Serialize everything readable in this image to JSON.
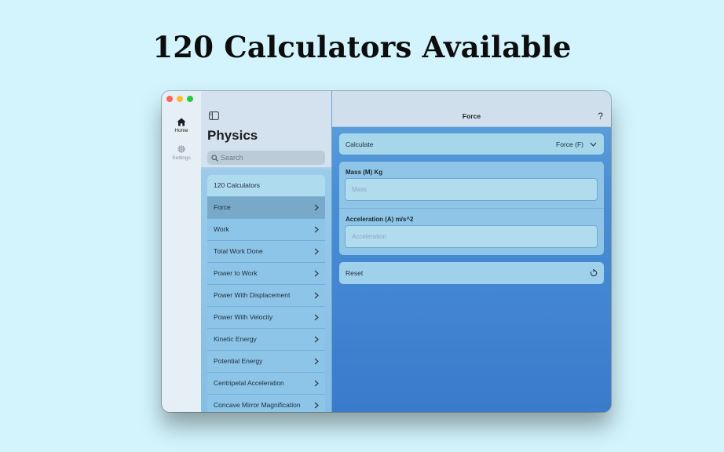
{
  "headline": "120 Calculators Available",
  "rail": {
    "items": [
      {
        "label": "Home",
        "icon": "house-icon"
      },
      {
        "label": "Settings",
        "icon": "gear-icon"
      }
    ]
  },
  "sidebar": {
    "title": "Physics",
    "search_placeholder": "Search",
    "list_header": "120 Calculators",
    "items": [
      {
        "label": "Force",
        "selected": true
      },
      {
        "label": "Work"
      },
      {
        "label": "Total Work Done"
      },
      {
        "label": "Power to Work"
      },
      {
        "label": "Power With Displacement"
      },
      {
        "label": "Power With Velocity"
      },
      {
        "label": "Kinetic Energy"
      },
      {
        "label": "Potential Energy"
      },
      {
        "label": "Centripetal Acceleration"
      },
      {
        "label": "Concave Mirror Magnification"
      }
    ]
  },
  "detail": {
    "title": "Force",
    "help": "?",
    "calculate_label": "Calculate",
    "calculate_value": "Force (F)",
    "fields": [
      {
        "label": "Mass (M) Kg",
        "placeholder": "Mass",
        "value": ""
      },
      {
        "label": "Acceleration (A) m/s^2",
        "placeholder": "Acceleration",
        "value": ""
      }
    ],
    "reset_label": "Reset"
  },
  "colors": {
    "page_background": "#d3f4fd",
    "detail_gradient_top": "#62a5dc",
    "detail_gradient_bottom": "#3a7bcc",
    "list_item": "#8cc5e8",
    "list_selected": "#79a9c9"
  }
}
